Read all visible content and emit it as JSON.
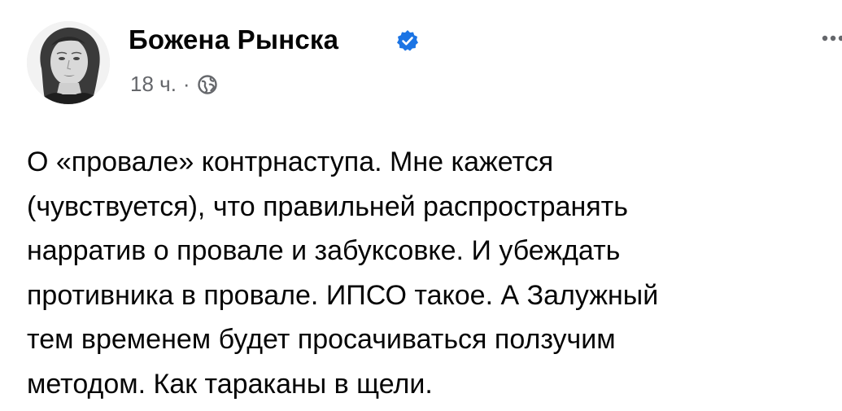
{
  "post": {
    "author": "Божена Рынска",
    "verified": true,
    "time": "18 ч.",
    "separator": "·",
    "audience_icon": "globe-icon",
    "more_icon": "more-options-icon",
    "text": "О «провале» контрнаступа. Мне кажется\n(чувствуется), что правильней распространять\nнарратив о провале и забуксовке. И убеждать\nпротивника в провале. ИПСО такое. А Залужный\nтем временем будет просачиваться ползучим\nметодом. Как тараканы в щели."
  },
  "colors": {
    "verified_badge": "#1b74e4",
    "meta_text": "#65676b",
    "body_text": "#050505"
  }
}
